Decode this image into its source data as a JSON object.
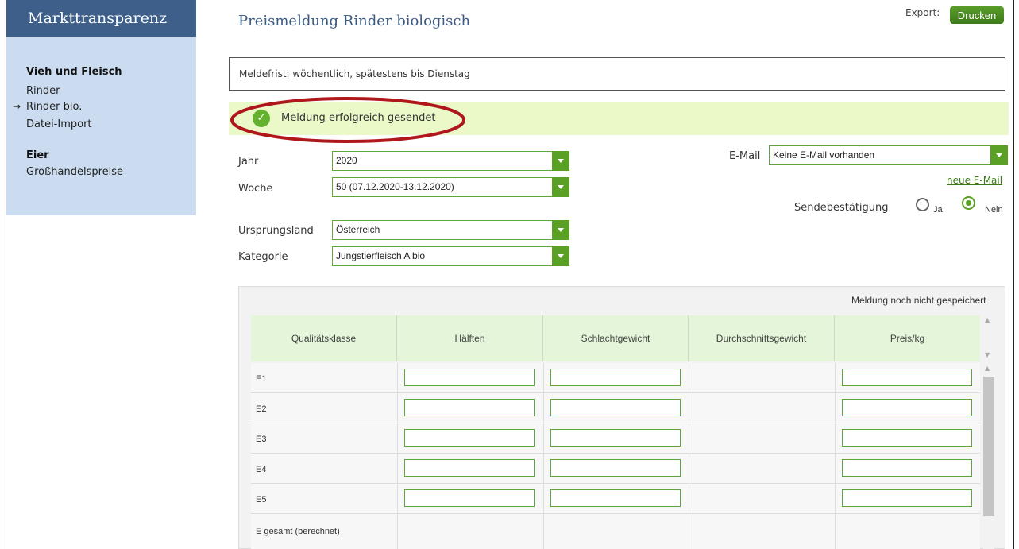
{
  "sidebar": {
    "title": "Markttransparenz",
    "groups": [
      {
        "label": "Vieh und Fleisch",
        "items": [
          {
            "label": "Rinder"
          },
          {
            "label": "Rinder bio.",
            "active": true
          },
          {
            "label": "Datei-Import"
          }
        ]
      },
      {
        "label": "Eier",
        "items": [
          {
            "label": "Großhandelspreise"
          }
        ]
      }
    ],
    "active_marker": "→"
  },
  "header": {
    "title": "Preismeldung Rinder biologisch",
    "export_label": "Export:",
    "print_label": "Drucken"
  },
  "notice": {
    "deadline": "Meldefrist: wöchentlich, spätestens bis Dienstag",
    "success": "Meldung erfolgreich gesendet",
    "success_icon": "checkmark-icon",
    "highlight_color": "#b0171b"
  },
  "form": {
    "year": {
      "label": "Jahr",
      "value": "2020"
    },
    "week": {
      "label": "Woche",
      "value": "50 (07.12.2020-13.12.2020)"
    },
    "origin": {
      "label": "Ursprungsland",
      "value": "Österreich"
    },
    "category": {
      "label": "Kategorie",
      "value": "Jungstierfleisch A bio"
    },
    "email": {
      "label": "E-Mail",
      "value": "Keine E-Mail vorhanden",
      "new_link": "neue E-Mail"
    },
    "confirmation": {
      "label": "Sendebestätigung",
      "options": [
        "Ja",
        "Nein"
      ],
      "selected": "Nein"
    }
  },
  "table": {
    "status": "Meldung noch nicht gespeichert",
    "columns": [
      "Qualitätsklasse",
      "Hälften",
      "Schlachtgewicht",
      "Durchschnittsgewicht",
      "Preis/kg"
    ],
    "rows": [
      "E1",
      "E2",
      "E3",
      "E4",
      "E5",
      "E gesamt (berechnet)"
    ]
  },
  "colors": {
    "accent_green": "#5aa025",
    "sidebar_header": "#3d5f8a",
    "sidebar_bg": "#cbdcf0",
    "success_bg": "#eaf9c7"
  }
}
